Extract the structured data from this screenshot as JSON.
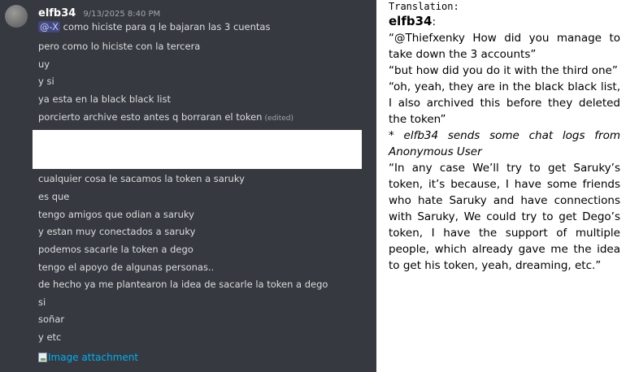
{
  "chat": {
    "username": "elfb34",
    "timestamp": "9/13/2025 8:40 PM",
    "messages": [
      {
        "mention": "@-X",
        "text": "como hiciste para q le bajaran las 3 cuentas"
      },
      {
        "text": "pero como lo hiciste con la tercera"
      },
      {
        "text": "uy"
      },
      {
        "text": "y si"
      },
      {
        "text": "ya esta en la black black list"
      },
      {
        "text": "porcierto archive esto antes q borraran el token",
        "edited": "(edited)"
      },
      {
        "text": "cualquier cosa le sacamos la token a saruky"
      },
      {
        "text": "es que"
      },
      {
        "text": "tengo amigos que odian a saruky"
      },
      {
        "text": "y estan muy conectados a saruky"
      },
      {
        "text": "podemos sacarle la token a dego"
      },
      {
        "text": "tengo el apoyo de algunas personas.."
      },
      {
        "text": "de hecho ya me plantearon la idea de sacarle la token a dego"
      },
      {
        "text": "si"
      },
      {
        "text": "soñar"
      },
      {
        "text": "y etc"
      }
    ],
    "attachment_label": "Image attachment"
  },
  "translation": {
    "title": "Translation:",
    "user": "elfb34",
    "user_suffix": ":",
    "lines": [
      "“@Thiefxenky How did you manage to take down the 3 accounts”",
      "“but how did you do it with the third one”",
      "“oh, yeah, they are in the black black list, I also archived this before they deleted the token”"
    ],
    "action": "* elfb34 sends some chat logs from Anonymous User",
    "closing": "“In any case We’ll try to get Saruky’s token, it’s because, I have some friends who hate Saruky and have connections with Saruky, We could try to get Dego’s token, I have the support of multiple people, which already gave me the idea to get his token, yeah, dreaming, etc.”"
  }
}
